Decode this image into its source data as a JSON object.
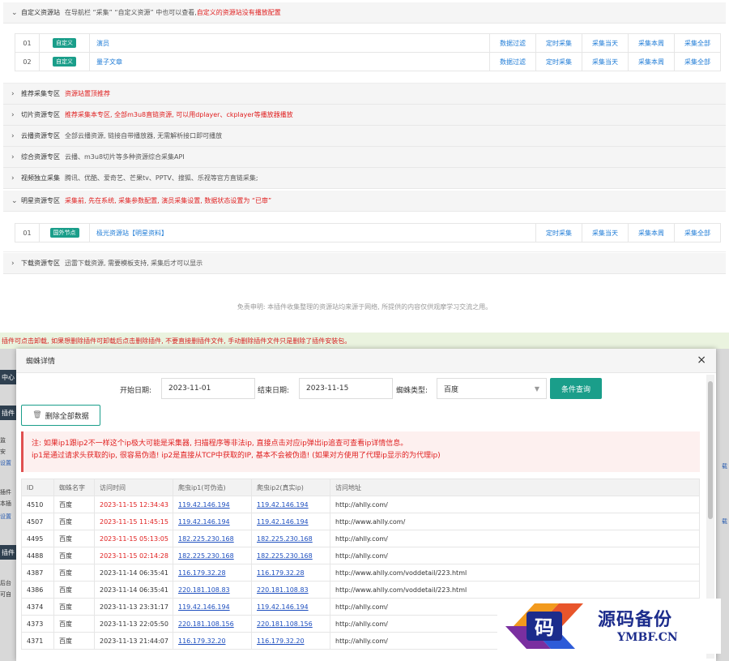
{
  "sections": {
    "custom": {
      "title": "自定义资源站",
      "desc": "在导航栏 “采集” “自定义资源” 中也可以查看,",
      "desc_red": "自定义的资源站没有播放配置"
    },
    "custom_rows": [
      {
        "num": "01",
        "tag": "自定义",
        "name": "演员",
        "actions": [
          "数据过滤",
          "定时采集",
          "采集当天",
          "采集本周",
          "采集全部"
        ]
      },
      {
        "num": "02",
        "tag": "自定义",
        "name": "量子文章",
        "actions": [
          "数据过滤",
          "定时采集",
          "采集当天",
          "采集本周",
          "采集全部"
        ]
      }
    ],
    "recommend": {
      "title": "推荐采集专区",
      "desc": "资源站置顶推荐"
    },
    "slice": {
      "title": "切片资源专区",
      "desc": "推荐采集本专区, 全部m3u8直链资源, 可以用dplayer、ckplayer等播放器播放"
    },
    "cloud": {
      "title": "云播资源专区",
      "desc": "全部云播资源, 链接自带播放器, 无需解析接口即可播放"
    },
    "general": {
      "title": "综合资源专区",
      "desc": "云播、m3u8切片等多种资源综合采集API"
    },
    "video": {
      "title": "视频独立采集",
      "desc": "腾讯、优酷、爱奇艺、芒果tv、PPTV、搜狐、乐视等官方直链采集;"
    },
    "star": {
      "title": "明星资源专区",
      "desc": "采集前, 先在系统, 采集参数配置, 演员采集设置, 数据状态设置为 “已审”"
    },
    "star_rows": [
      {
        "num": "01",
        "tag": "国外节点",
        "name": "极光资源站【明星资料】",
        "actions": [
          "定时采集",
          "采集当天",
          "采集本周",
          "采集全部"
        ]
      }
    ],
    "download": {
      "title": "下载资源专区",
      "desc": "迅雷下载资源, 需要模板支持, 采集后才可以显示"
    }
  },
  "disclaimer": "免责申明: 本插件收集整理的资源站均来源于网络, 所提供的内容仅供观摩学习交流之用。",
  "background": {
    "notice": "插件可点击卸载, 如果想删除插件可卸载后点击删除插件, 不要直接删插件文件, 手动删除插件文件只是删除了插件安装包。",
    "left_items": [
      "中心",
      "插件",
      "插件"
    ],
    "left_texts": [
      "监",
      "安",
      "设置",
      "插件",
      "本插",
      "设置",
      "后台",
      "可自"
    ],
    "right_links": [
      "载",
      "载"
    ]
  },
  "modal": {
    "title": "蜘蛛详情",
    "start_label": "开始日期:",
    "start_value": "2023-11-01",
    "end_label": "结束日期:",
    "end_value": "2023-11-15",
    "type_label": "蜘蛛类型:",
    "type_value": "百度",
    "query_button": "条件查询",
    "delete_button": "删除全部数据",
    "warn_line1": "注: 如果ip1跟ip2不一样这个ip极大可能是采集器, 扫描程序等非法ip, 直接点击对应ip弹出ip追查可查看ip详情信息。",
    "warn_line2": "ip1是通过请求头获取的ip, 很容易伪造! ip2是直接从TCP中获取的IP, 基本不会被伪造! (如果对方使用了代理ip显示的为代理ip)",
    "columns": [
      "ID",
      "蜘蛛名字",
      "访问时间",
      "爬虫ip1(可伪造)",
      "爬虫ip2(真实ip)",
      "访问地址"
    ],
    "rows": [
      {
        "id": "4510",
        "name": "百度",
        "time": "2023-11-15 12:34:43",
        "recent": true,
        "ip1": "119.42.146.194",
        "ip2": "119.42.146.194",
        "url": "http://ahlly.com/"
      },
      {
        "id": "4507",
        "name": "百度",
        "time": "2023-11-15 11:45:15",
        "recent": true,
        "ip1": "119.42.146.194",
        "ip2": "119.42.146.194",
        "url": "http://www.ahlly.com/"
      },
      {
        "id": "4495",
        "name": "百度",
        "time": "2023-11-15 05:13:05",
        "recent": true,
        "ip1": "182.225.230.168",
        "ip2": "182.225.230.168",
        "url": "http://ahlly.com/"
      },
      {
        "id": "4488",
        "name": "百度",
        "time": "2023-11-15 02:14:28",
        "recent": true,
        "ip1": "182.225.230.168",
        "ip2": "182.225.230.168",
        "url": "http://ahlly.com/"
      },
      {
        "id": "4387",
        "name": "百度",
        "time": "2023-11-14 06:35:41",
        "recent": false,
        "ip1": "116.179.32.28",
        "ip2": "116.179.32.28",
        "url": "http://www.ahlly.com/voddetail/223.html"
      },
      {
        "id": "4386",
        "name": "百度",
        "time": "2023-11-14 06:35:41",
        "recent": false,
        "ip1": "220.181.108.83",
        "ip2": "220.181.108.83",
        "url": "http://www.ahlly.com/voddetail/223.html"
      },
      {
        "id": "4374",
        "name": "百度",
        "time": "2023-11-13 23:31:17",
        "recent": false,
        "ip1": "119.42.146.194",
        "ip2": "119.42.146.194",
        "url": "http://ahlly.com/"
      },
      {
        "id": "4373",
        "name": "百度",
        "time": "2023-11-13 22:05:50",
        "recent": false,
        "ip1": "220.181.108.156",
        "ip2": "220.181.108.156",
        "url": "http://ahlly.com/"
      },
      {
        "id": "4371",
        "name": "百度",
        "time": "2023-11-13 21:44:07",
        "recent": false,
        "ip1": "116.179.32.20",
        "ip2": "116.179.32.20",
        "url": "http://ahlly.com/"
      }
    ]
  },
  "watermark": {
    "cn": "源码备份",
    "en": "YMBF.CN",
    "glyph": "码"
  },
  "colors": {
    "accent": "#1a9e8a",
    "danger": "#e02020",
    "link": "#1e7bd6",
    "brand_navy": "#1c2c8c"
  }
}
